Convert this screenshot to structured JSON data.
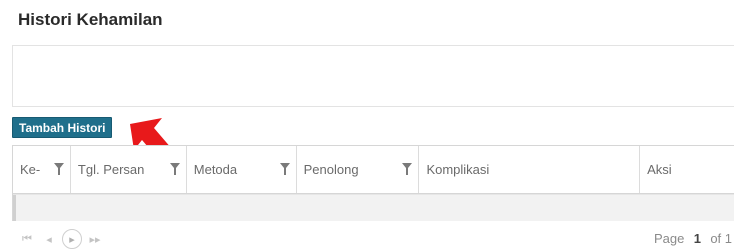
{
  "section": {
    "title": "Histori Kehamilan"
  },
  "toolbar": {
    "add_label": "Tambah Histori"
  },
  "grid": {
    "columns": [
      {
        "label": "Ke-",
        "filter": true
      },
      {
        "label": "Tgl. Persan",
        "filter": true
      },
      {
        "label": "Metoda",
        "filter": true
      },
      {
        "label": "Penolong",
        "filter": true
      },
      {
        "label": "Komplikasi",
        "filter": false
      },
      {
        "label": "Aksi",
        "filter": false
      }
    ],
    "rows": []
  },
  "pager": {
    "first_icon": "first-page-icon",
    "prev_icon": "prev-page-icon",
    "next_icon": "next-page-icon",
    "last_icon": "last-page-icon",
    "page_label": "Page",
    "current_page": "1",
    "of_label": "of 1"
  },
  "colors": {
    "accent": "#1f6f8b",
    "annotation_arrow": "#e8191b"
  }
}
